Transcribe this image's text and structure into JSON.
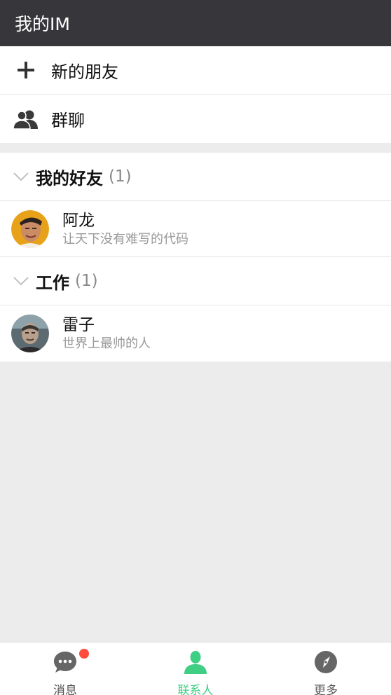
{
  "app": {
    "title": "我的IM"
  },
  "menu": {
    "new_friends": "新的朋友",
    "group_chat": "群聊"
  },
  "groups": [
    {
      "title": "我的好友",
      "count": "(1)",
      "contacts": [
        {
          "name": "阿龙",
          "signature": "让天下没有难写的代码"
        }
      ]
    },
    {
      "title": "工作",
      "count": "(1)",
      "contacts": [
        {
          "name": "雷子",
          "signature": "世界上最帅的人"
        }
      ]
    }
  ],
  "tabs": [
    {
      "label": "消息",
      "icon": "chat-bubble-icon",
      "badge": true
    },
    {
      "label": "联系人",
      "icon": "person-icon",
      "active": true
    },
    {
      "label": "更多",
      "icon": "compass-icon"
    }
  ],
  "colors": {
    "topbar": "#37373b",
    "accent_green": "#3fcf84",
    "badge_red": "#ff4d3d",
    "background": "#ececec"
  }
}
